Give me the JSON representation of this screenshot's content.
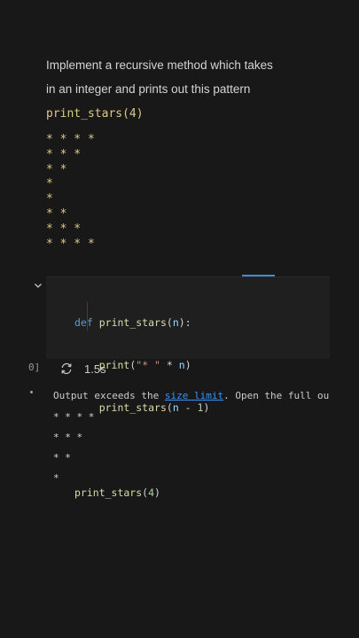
{
  "markdown": {
    "line1": "Implement a recursive method which takes",
    "line2": "in an integer and prints out this pattern",
    "code_call": "print_stars(4)",
    "pattern": [
      "* * * *",
      "* * *",
      "* *",
      "*",
      "*",
      "* *",
      "* * *",
      "* * * *"
    ]
  },
  "code": {
    "def_kw": "def",
    "fn_name": "print_stars",
    "param": "n",
    "print_fn": "print",
    "str_literal": "\"* \"",
    "num_literal": "1",
    "call_fn": "print_stars",
    "call_arg": "4"
  },
  "execution": {
    "count": "0]",
    "duration": "1.5s"
  },
  "output": {
    "msg_prefix": "Output exceeds the ",
    "link": "size limit",
    "msg_suffix": ". Open the full output data in a text editor",
    "lines": [
      "* * * *",
      "* * *",
      "* *",
      "*"
    ]
  },
  "colors": {
    "background": "#181818",
    "code_yellow": "#dcc98a",
    "link_blue": "#3794ff",
    "accent": "#3b8fd6"
  },
  "icons": [
    "chevron-down-icon",
    "sync-icon"
  ]
}
